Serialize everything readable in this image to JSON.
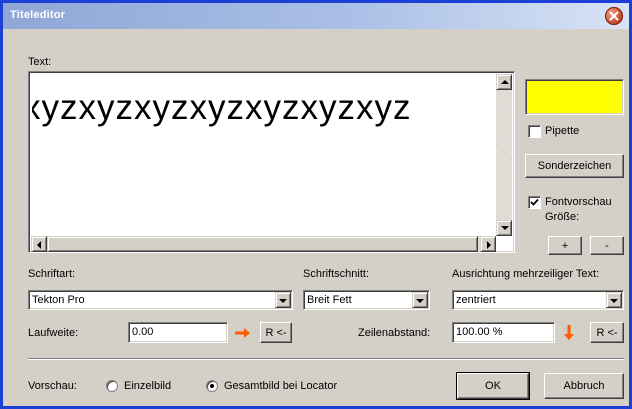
{
  "window": {
    "title": "Titeleditor"
  },
  "text_section": {
    "label": "Text:",
    "preview_text": "xyzxyzxyzxyzxyzxyzxyz"
  },
  "color": {
    "swatch": "#ffff00",
    "pipette_label": "Pipette",
    "pipette_checked": false
  },
  "special_chars_button": "Sonderzeichen",
  "font_preview": {
    "label": "Fontvorschau",
    "checked": true
  },
  "size": {
    "label": "Größe:",
    "plus": "+",
    "minus": "-"
  },
  "font": {
    "label": "Schriftart:",
    "value": "Tekton Pro"
  },
  "style": {
    "label": "Schriftschnitt:",
    "value": "Breit Fett"
  },
  "alignment": {
    "label": "Ausrichtung mehrzeiliger Text:",
    "value": "zentriert"
  },
  "tracking": {
    "label": "Laufweite:",
    "value": "0.00",
    "reset": "R <-"
  },
  "line_spacing": {
    "label": "Zeilenabstand:",
    "value": "100.00 %",
    "reset": "R <-"
  },
  "preview": {
    "label": "Vorschau:",
    "options": [
      {
        "label": "Einzelbild",
        "selected": false
      },
      {
        "label": "Gesamtbild bei Locator",
        "selected": true
      }
    ]
  },
  "buttons": {
    "ok": "OK",
    "cancel": "Abbruch"
  },
  "colors": {
    "title_bar_start": "#8fa7d6",
    "window_border": "#1c3fd6",
    "arrow_orange": "#ff5a00"
  }
}
